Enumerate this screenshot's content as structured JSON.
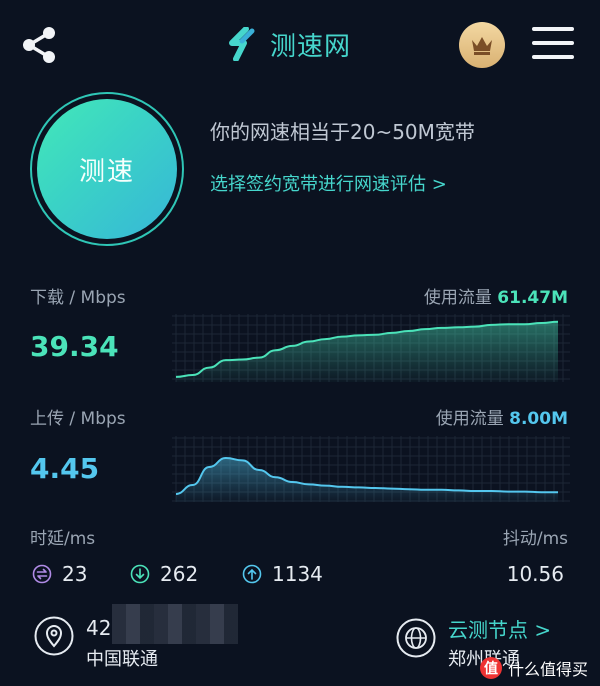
{
  "header": {
    "app_name": "测速网",
    "share_icon": "share-icon",
    "crown_icon": "crown-icon",
    "menu_icon": "menu-icon"
  },
  "speed_test": {
    "button_label": "测速",
    "bandwidth_text": "你的网速相当于20~50M宽带",
    "bandwidth_link": "选择签约宽带进行网速评估 >"
  },
  "download": {
    "label": "下载 / Mbps",
    "value": "39.34",
    "traffic_label": "使用流量",
    "traffic_value": "61.47M",
    "color": "#4be3b9",
    "curve": [
      0.05,
      0.08,
      0.2,
      0.32,
      0.33,
      0.36,
      0.48,
      0.55,
      0.62,
      0.66,
      0.7,
      0.72,
      0.73,
      0.76,
      0.79,
      0.82,
      0.84,
      0.85,
      0.86,
      0.89,
      0.9,
      0.9,
      0.92,
      0.94
    ]
  },
  "upload": {
    "label": "上传 / Mbps",
    "value": "4.45",
    "traffic_label": "使用流量",
    "traffic_value": "8.00M",
    "color": "#54c7ee",
    "curve": [
      0.1,
      0.25,
      0.55,
      0.7,
      0.66,
      0.5,
      0.38,
      0.3,
      0.26,
      0.24,
      0.22,
      0.21,
      0.2,
      0.19,
      0.18,
      0.17,
      0.17,
      0.16,
      0.15,
      0.15,
      0.14,
      0.14,
      0.13,
      0.13
    ]
  },
  "latency": {
    "label": "时延/ms",
    "idle": "23",
    "download": "262",
    "upload": "1134",
    "jitter_label": "抖动/ms",
    "jitter": "10.56"
  },
  "client": {
    "ip_partial": "42",
    "isp": "中国联通"
  },
  "node": {
    "link": "云测节点 >",
    "isp": "郑州联通"
  },
  "watermark": {
    "badge": "值",
    "text": "什么值得买"
  }
}
